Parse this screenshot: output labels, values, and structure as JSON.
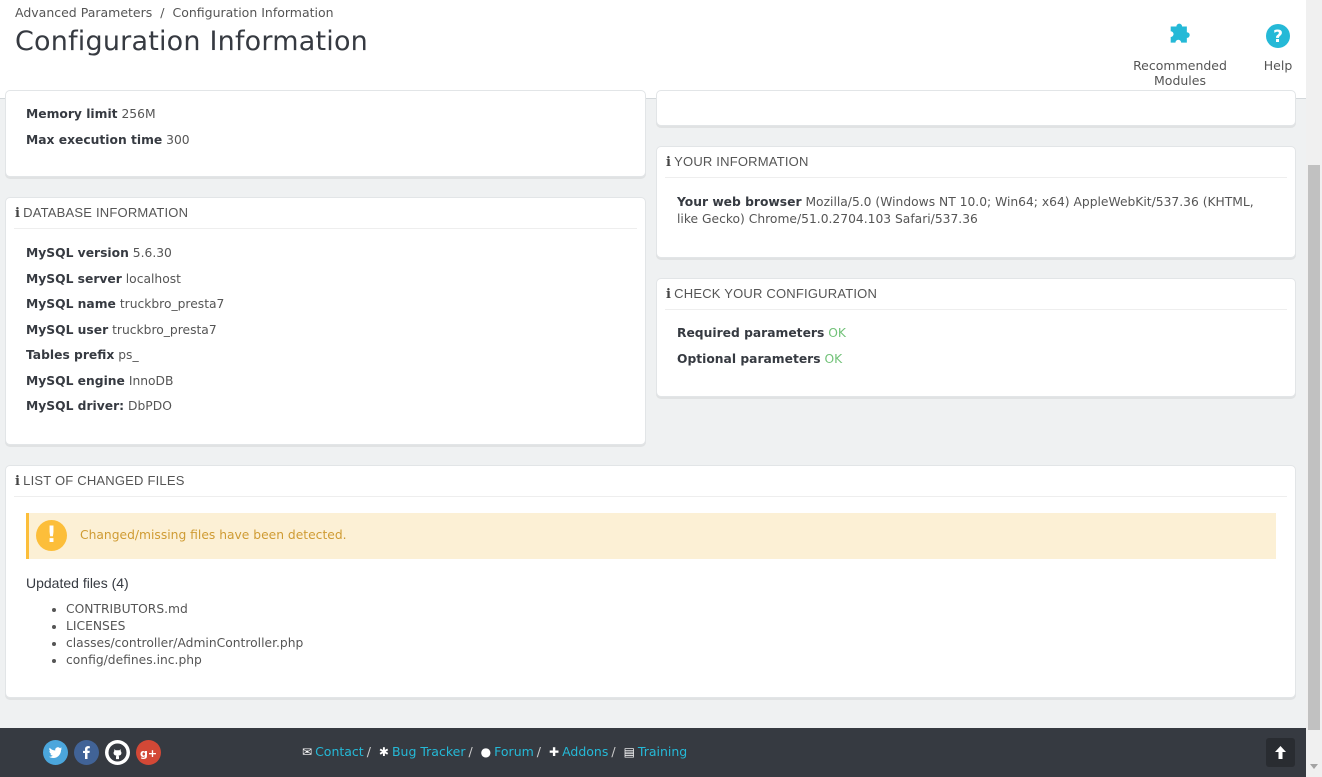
{
  "header": {
    "breadcrumb": [
      "Advanced Parameters",
      "Configuration Information"
    ],
    "breadcrumb_sep": "/",
    "title": "Configuration Information",
    "toolbar": {
      "recommended_modules": "Recommended Modules",
      "help": "Help"
    }
  },
  "server_panel": {
    "memory_limit_label": "Memory limit",
    "memory_limit_value": "256M",
    "max_exec_label": "Max execution time",
    "max_exec_value": "300"
  },
  "database": {
    "heading": "DATABASE INFORMATION",
    "rows": [
      {
        "label": "MySQL version",
        "value": "5.6.30"
      },
      {
        "label": "MySQL server",
        "value": "localhost"
      },
      {
        "label": "MySQL name",
        "value": "truckbro_presta7"
      },
      {
        "label": "MySQL user",
        "value": "truckbro_presta7"
      },
      {
        "label": "Tables prefix",
        "value": "ps_"
      },
      {
        "label": "MySQL engine",
        "value": "InnoDB"
      },
      {
        "label": "MySQL driver:",
        "value": "DbPDO"
      }
    ]
  },
  "your_info": {
    "heading": "YOUR INFORMATION",
    "browser_label": "Your web browser",
    "browser_value": "Mozilla/5.0 (Windows NT 10.0; Win64; x64) AppleWebKit/537.36 (KHTML, like Gecko) Chrome/51.0.2704.103 Safari/537.36"
  },
  "check_config": {
    "heading": "CHECK YOUR CONFIGURATION",
    "required_label": "Required parameters",
    "required_value": "OK",
    "optional_label": "Optional parameters",
    "optional_value": "OK"
  },
  "changed_files": {
    "heading": "LIST OF CHANGED FILES",
    "alert": "Changed/missing files have been detected.",
    "updated_title": "Updated files (4)",
    "files": [
      "CONTRIBUTORS.md",
      "LICENSES",
      "classes/controller/AdminController.php",
      "config/defines.inc.php"
    ]
  },
  "footer": {
    "links": [
      {
        "icon": "envelope-icon",
        "label": "Contact"
      },
      {
        "icon": "bug-icon",
        "label": "Bug Tracker"
      },
      {
        "icon": "comments-icon",
        "label": "Forum"
      },
      {
        "icon": "puzzle-icon",
        "label": "Addons"
      },
      {
        "icon": "book-icon",
        "label": "Training"
      }
    ],
    "separator": "/"
  },
  "colors": {
    "accent": "#25b9d7",
    "footer_bg": "#363a41",
    "ok_green": "#72c279",
    "warning": "#fcbe3a",
    "warning_bg": "#fcf0d5"
  }
}
